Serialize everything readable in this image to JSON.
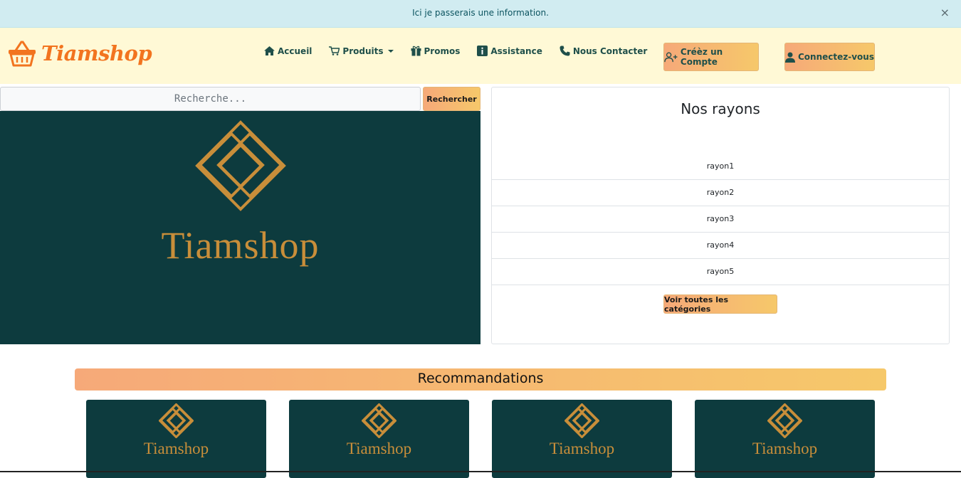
{
  "alert": {
    "message": "Ici je passerais une information.",
    "close": "×"
  },
  "brand": {
    "name": "Tiamshop",
    "icon": "basket-icon",
    "color": "#f2741f"
  },
  "nav": {
    "items": [
      {
        "label": "Accueil",
        "icon": "home-icon"
      },
      {
        "label": "Produits",
        "icon": "cart-icon",
        "dropdown": true
      },
      {
        "label": "Promos",
        "icon": "gift-icon"
      },
      {
        "label": "Assistance",
        "icon": "info-icon"
      },
      {
        "label": "Nous Contacter",
        "icon": "phone-icon"
      }
    ]
  },
  "auth": {
    "create_account": "Créèz un Compte",
    "login": "Connectez-vous"
  },
  "search": {
    "placeholder": "Recherche...",
    "button": "Rechercher"
  },
  "hero": {
    "logo_text": "Tiamshop"
  },
  "rayons": {
    "title": "Nos rayons",
    "items": [
      "rayon1",
      "rayon2",
      "rayon3",
      "rayon4",
      "rayon5"
    ],
    "see_all": "Voir toutes les catégories"
  },
  "recommendations": {
    "title": "Recommandations",
    "cards": [
      "Tiamshop",
      "Tiamshop",
      "Tiamshop",
      "Tiamshop"
    ]
  },
  "colors": {
    "accent_gradient_start": "#f6a979",
    "accent_gradient_end": "#f6c86a",
    "dark_teal": "#0d3b3e",
    "gold": "#c88e3a",
    "navbar_bg": "#fff9d6",
    "alert_bg": "#d1ecf1"
  }
}
